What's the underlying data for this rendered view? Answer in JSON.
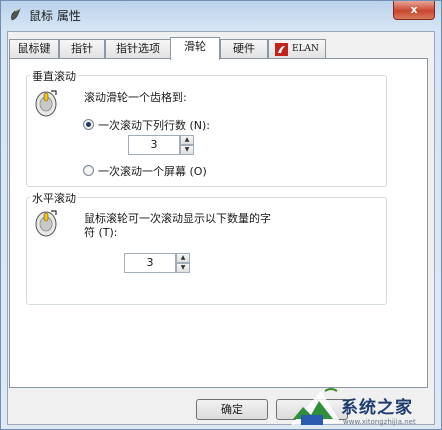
{
  "window": {
    "title": "鼠标 属性",
    "close_label": "x"
  },
  "tabs": [
    {
      "label": "鼠标键"
    },
    {
      "label": "指针"
    },
    {
      "label": "指针选项"
    },
    {
      "label": "滑轮"
    },
    {
      "label": "硬件"
    },
    {
      "label": "ELAN"
    }
  ],
  "active_tab": "滑轮",
  "vertical": {
    "title": "垂直滚动",
    "desc": "滚动滑轮一个齿格到:",
    "option_lines_label": "一次滚动下列行数 (N):",
    "lines_value": "3",
    "option_screen_label": "一次滚动一个屏幕 (O)"
  },
  "horizontal": {
    "title": "水平滚动",
    "desc_line1": "鼠标滚轮可一次滚动显示以下数量的字",
    "desc_line2": "符 (T):",
    "chars_value": "3"
  },
  "footer": {
    "ok_label": "确定"
  },
  "watermark": {
    "text": "系统之家",
    "url": "www.xitongzhijia.net"
  }
}
